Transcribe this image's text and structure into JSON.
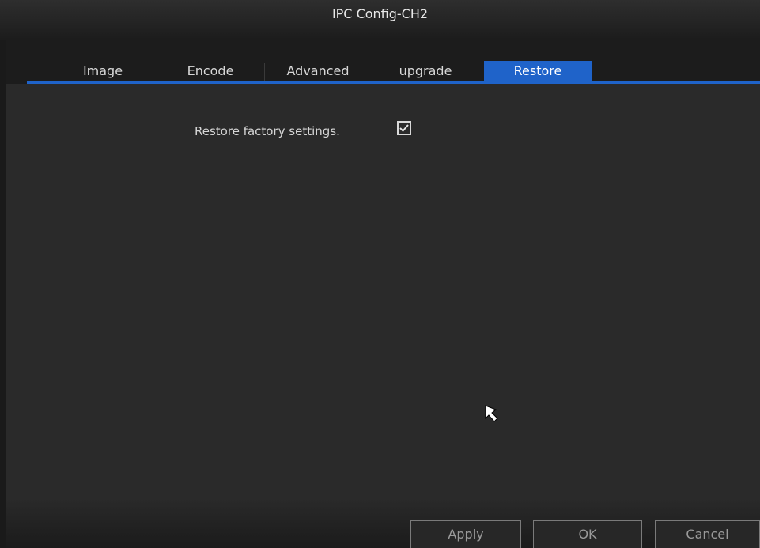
{
  "window": {
    "title": "IPC Config-CH2"
  },
  "tabs": [
    {
      "label": "Image"
    },
    {
      "label": "Encode"
    },
    {
      "label": "Advanced"
    },
    {
      "label": "upgrade"
    },
    {
      "label": "Restore"
    }
  ],
  "active_tab": "Restore",
  "restore": {
    "label": "Restore factory settings.",
    "checked": true
  },
  "buttons": {
    "apply": "Apply",
    "ok": "OK",
    "cancel": "Cancel"
  },
  "colors": {
    "accent": "#1f63c9",
    "background": "#2a2a2a",
    "text": "#d6d6d6"
  }
}
